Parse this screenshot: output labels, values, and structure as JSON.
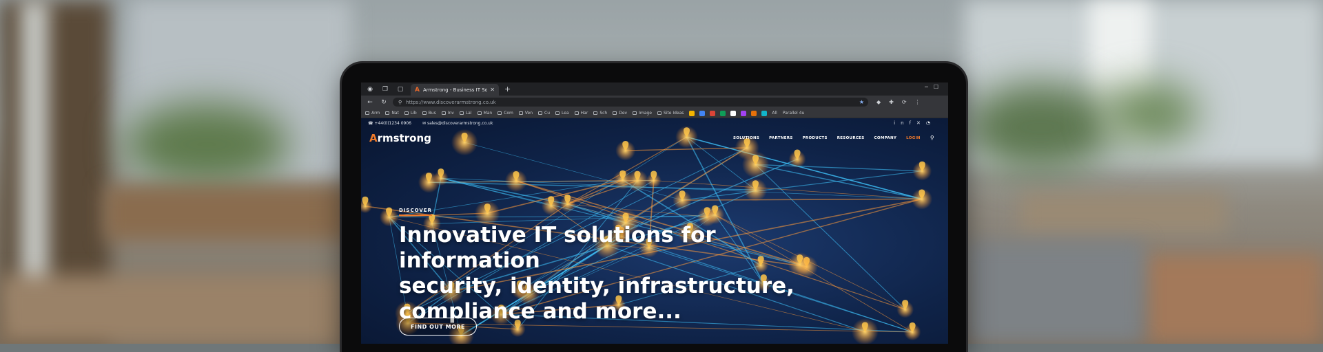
{
  "browser": {
    "tab_title": "Armstrong - Business IT Solutions",
    "tab_favicon": "A",
    "url": "https://www.discoverarmstrong.co.uk",
    "bookmarks": [
      "Arm",
      "Nat",
      "Lib",
      "Bus",
      "Inv",
      "Lal",
      "Man",
      "Com",
      "Ven",
      "Cu",
      "Lea",
      "Har",
      "Sch",
      "Dev",
      "Image",
      "Site Ideas"
    ],
    "bookmark_end": [
      "All",
      "Parallel 4u"
    ]
  },
  "site": {
    "phone": "+44(0)1234 0906",
    "email": "sales@discoverarmstrong.co.uk",
    "logo_mark": "A",
    "logo_rest": "rmstrong",
    "menu": [
      "SOLUTIONS",
      "PARTNERS",
      "PRODUCTS",
      "RESOURCES",
      "COMPANY"
    ],
    "login": "LOGIN",
    "eyebrow": "DISCOVER",
    "headline_lines": [
      "Innovative IT solutions for information",
      "security, identity, infrastructure,",
      "compliance and more..."
    ],
    "cta": "FIND OUT MORE"
  },
  "icons": {
    "social": [
      "linkedin-icon",
      "facebook-icon",
      "x-icon",
      "rss-icon"
    ]
  },
  "colors": {
    "accent": "#f07a2a",
    "site_bg": "#0f2348",
    "browser_chrome": "#35363a"
  }
}
